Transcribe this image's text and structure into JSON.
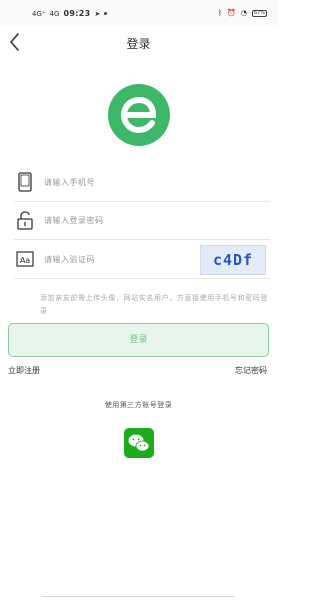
{
  "status_bar": {
    "signal_1": "4G⁺",
    "signal_2": "4G",
    "time": "09:23",
    "battery": "67%"
  },
  "nav": {
    "title": "登录",
    "back_icon": "chevron-left-icon"
  },
  "logo": {
    "icon": "green-e-logo",
    "color": "#3db868"
  },
  "form": {
    "phone_placeholder": "请输入手机号",
    "password_placeholder": "请输入登录密码",
    "captcha_placeholder": "请输入验证码",
    "captcha_text": "c4Df",
    "icons": {
      "phone": "phone-icon",
      "password": "lock-icon",
      "captcha": "text-aa-icon"
    }
  },
  "hint": "添加亲友前需上传头像，网站实名用户，方直接使用手机号和密码登录",
  "login_button": "登录",
  "register_link": "立即注册",
  "forgot_link": "忘记密码",
  "third_party_label": "使用第三方账号登录",
  "wechat_icon": "wechat-icon",
  "colors": {
    "accent": "#3db868",
    "button_bg": "#e8f5ec",
    "button_border": "#8ccca1",
    "wechat": "#1aad19"
  }
}
